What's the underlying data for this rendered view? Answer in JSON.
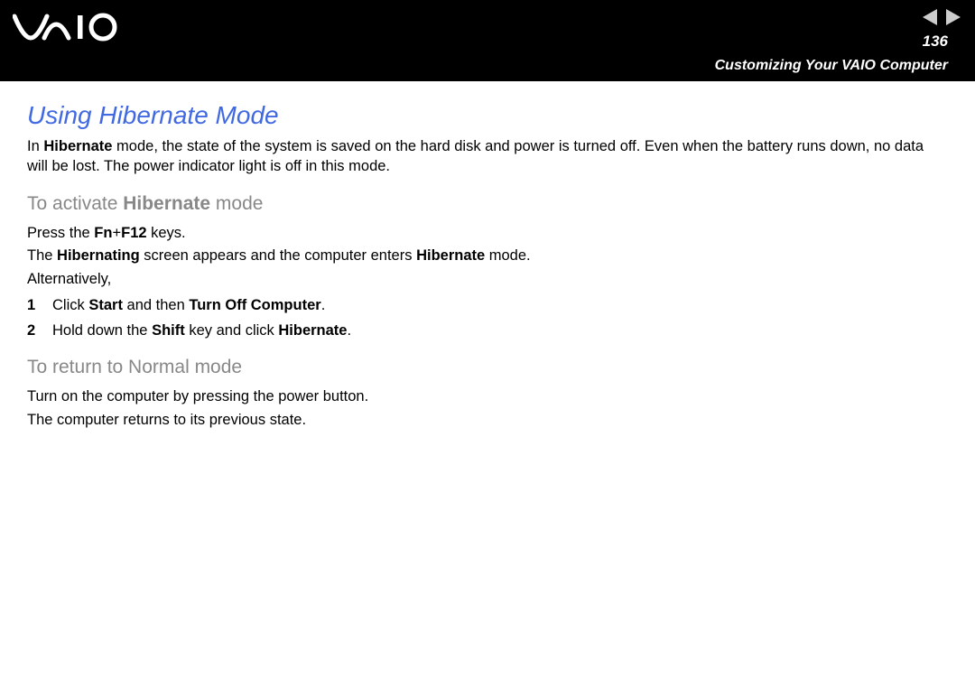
{
  "header": {
    "page_number": "136",
    "section": "Customizing Your VAIO Computer"
  },
  "title": "Using Hibernate Mode",
  "intro": {
    "pre": "In ",
    "bold1": "Hibernate",
    "post": " mode, the state of the system is saved on the hard disk and power is turned off. Even when the battery runs down, no data will be lost. The power indicator light is off in this mode."
  },
  "activate": {
    "heading_pre": "To activate ",
    "heading_bold": "Hibernate",
    "heading_post": " mode",
    "line1_pre": "Press the ",
    "line1_bold": "Fn",
    "line1_mid": "+",
    "line1_bold2": "F12",
    "line1_post": " keys.",
    "line2_pre": "The ",
    "line2_bold": "Hibernating",
    "line2_mid": " screen appears and the computer enters ",
    "line2_bold2": "Hibernate",
    "line2_post": " mode.",
    "line3": "Alternatively,",
    "steps": [
      {
        "num": "1",
        "pre": "Click ",
        "b1": "Start",
        "mid": " and then ",
        "b2": "Turn Off Computer",
        "post": "."
      },
      {
        "num": "2",
        "pre": "Hold down the ",
        "b1": "Shift",
        "mid": " key and click ",
        "b2": "Hibernate",
        "post": "."
      }
    ]
  },
  "return": {
    "heading": "To return to Normal mode",
    "line1": "Turn on the computer by pressing the power button.",
    "line2": "The computer returns to its previous state."
  }
}
